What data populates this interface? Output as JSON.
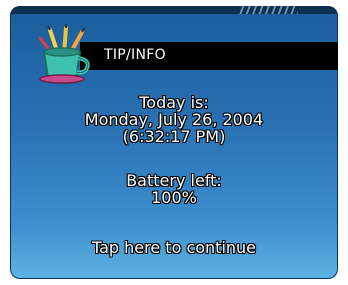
{
  "window": {
    "title": "TIP/INFO",
    "accent_color": "#2a72b3",
    "title_bar_color": "#000000"
  },
  "icon": "pencil-cup-icon",
  "date": {
    "label": "Today is:",
    "value": "Monday, July 26, 2004",
    "time": "(6:32:17 PM)"
  },
  "battery": {
    "label": "Battery left:",
    "value": "100%"
  },
  "continue_label": "Tap here to continue"
}
